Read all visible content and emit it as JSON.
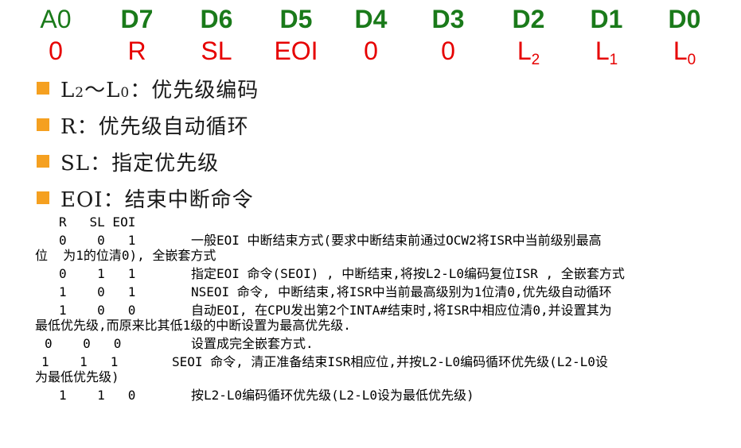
{
  "bits": {
    "names": [
      "A0",
      "D7",
      "D6",
      "D5",
      "D4",
      "D3",
      "D2",
      "D1",
      "D0"
    ],
    "values": [
      {
        "main": "0",
        "sub": ""
      },
      {
        "main": "R",
        "sub": ""
      },
      {
        "main": "SL",
        "sub": ""
      },
      {
        "main": "EOI",
        "sub": ""
      },
      {
        "main": "0",
        "sub": ""
      },
      {
        "main": "0",
        "sub": ""
      },
      {
        "main": "L",
        "sub": "2"
      },
      {
        "main": "L",
        "sub": "1"
      },
      {
        "main": "L",
        "sub": "0"
      }
    ]
  },
  "bullets": [
    {
      "parts": [
        {
          "t": "L",
          "s": false
        },
        {
          "t": "2",
          "s": true
        },
        {
          "t": "～L",
          "s": false
        },
        {
          "t": "0",
          "s": true
        },
        {
          "t": "：优先级编码",
          "s": false
        }
      ]
    },
    {
      "parts": [
        {
          "t": "R：优先级自动循环",
          "s": false
        }
      ]
    },
    {
      "parts": [
        {
          "t": "SL：指定优先级",
          "s": false
        }
      ]
    },
    {
      "parts": [
        {
          "t": "EOI：结束中断命令",
          "s": false
        }
      ]
    }
  ],
  "modes": {
    "header": "R   SL EOI",
    "rows": [
      {
        "bits": "0    0   1",
        "text": "一般EOI 中断结束方式(要求中断结束前通过OCW2将ISR中当前级别最高",
        "cont": "位  为1的位清0), 全嵌套方式"
      },
      {
        "bits": "0    1   1",
        "text": "指定EOI 命令(SEOI) , 中断结束,将按L2-L0编码复位ISR , 全嵌套方式",
        "cont": ""
      },
      {
        "bits": "1    0   1",
        "text": "NSEOI 命令, 中断结束,将ISR中当前最高级别为1位清0,优先级自动循环",
        "cont": ""
      },
      {
        "bits": "1    0   0",
        "text": "自动EOI, 在CPU发出第2个INTA#结束时,将ISR中相应位清0,并设置其为",
        "cont": "最低优先级,而原来比其低1级的中断设置为最高优先级."
      },
      {
        "bits": "0    0   0",
        "text": "设置成完全嵌套方式.",
        "cont": ""
      },
      {
        "bits": "1    1   1",
        "text": "SEOI 命令, 清正准备结束ISR相应位,并按L2-L0编码循环优先级(L2-L0设",
        "cont": "为最低优先级)"
      },
      {
        "bits": "1    1   0",
        "text": "按L2-L0编码循环优先级(L2-L0设为最低优先级)",
        "cont": ""
      }
    ]
  },
  "colors": {
    "bit_name": "#1a7a1a",
    "bit_value": "#e60000",
    "bullet_square": "#f5a020"
  }
}
